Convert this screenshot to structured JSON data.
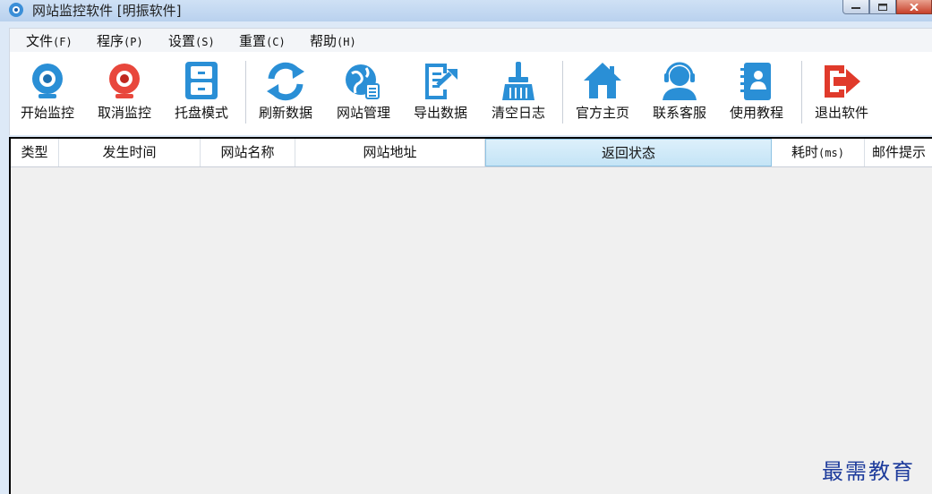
{
  "window": {
    "title": "网站监控软件 [明振软件]",
    "app_icon": "monitor-app-icon"
  },
  "menu": {
    "items": [
      {
        "label": "文件",
        "hotkey": "(F)"
      },
      {
        "label": "程序",
        "hotkey": "(P)"
      },
      {
        "label": "设置",
        "hotkey": "(S)"
      },
      {
        "label": "重置",
        "hotkey": "(C)"
      },
      {
        "label": "帮助",
        "hotkey": "(H)"
      }
    ]
  },
  "toolbar": {
    "start_label": "开始监控",
    "cancel_label": "取消监控",
    "tray_label": "托盘模式",
    "refresh_label": "刷新数据",
    "sites_label": "网站管理",
    "export_label": "导出数据",
    "clear_label": "清空日志",
    "home_label": "官方主页",
    "support_label": "联系客服",
    "tutorial_label": "使用教程",
    "exit_label": "退出软件"
  },
  "columns": [
    {
      "label": "类型"
    },
    {
      "label": "发生时间"
    },
    {
      "label": "网站名称"
    },
    {
      "label": "网站地址"
    },
    {
      "label": "返回状态"
    },
    {
      "label": "耗时",
      "unit": "(ms)"
    },
    {
      "label": "邮件提示"
    }
  ],
  "watermark": "最需教育",
  "colors": {
    "accent_blue": "#2a8fd6",
    "cancel_red": "#e8473c",
    "exit_red": "#e03a2b",
    "header_selected": "#c4e4f6",
    "watermark": "#1e3c9c"
  }
}
